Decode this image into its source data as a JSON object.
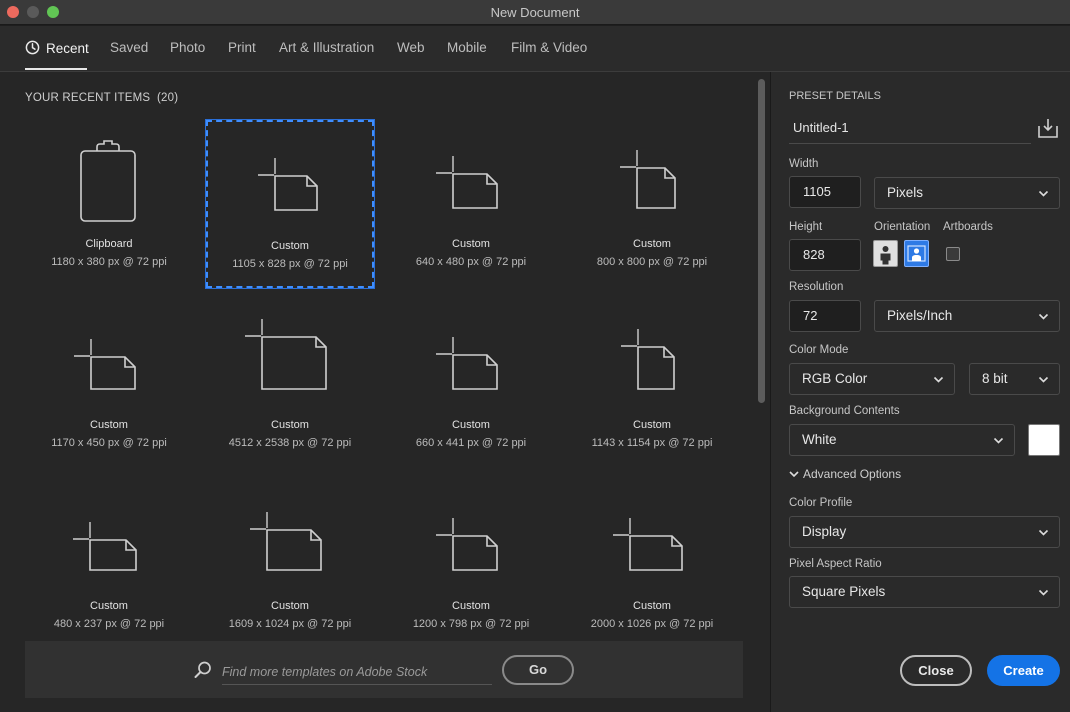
{
  "window": {
    "title": "New Document"
  },
  "tabs": [
    {
      "label": "Recent",
      "active": true
    },
    {
      "label": "Saved"
    },
    {
      "label": "Photo"
    },
    {
      "label": "Print"
    },
    {
      "label": "Art & Illustration"
    },
    {
      "label": "Web"
    },
    {
      "label": "Mobile"
    },
    {
      "label": "Film & Video"
    }
  ],
  "recent": {
    "title": "YOUR RECENT ITEMS",
    "count": "(20)",
    "items": [
      {
        "name": "Clipboard",
        "size": "1180 x 380 px @ 72 ppi",
        "icon": "clipboard-icon"
      },
      {
        "name": "Custom",
        "size": "1105 x 828 px @ 72 ppi",
        "icon": "document-icon",
        "selected": true
      },
      {
        "name": "Custom",
        "size": "640 x 480 px @ 72 ppi",
        "icon": "document-icon"
      },
      {
        "name": "Custom",
        "size": "800 x 800 px @ 72 ppi",
        "icon": "document-icon"
      },
      {
        "name": "Custom",
        "size": "1170 x 450 px @ 72 ppi",
        "icon": "document-icon"
      },
      {
        "name": "Custom",
        "size": "4512 x 2538 px @ 72 ppi",
        "icon": "document-icon"
      },
      {
        "name": "Custom",
        "size": "660 x 441 px @ 72 ppi",
        "icon": "document-icon"
      },
      {
        "name": "Custom",
        "size": "1143 x 1154 px @ 72 ppi",
        "icon": "document-icon"
      },
      {
        "name": "Custom",
        "size": "480 x 237 px @ 72 ppi",
        "icon": "document-icon"
      },
      {
        "name": "Custom",
        "size": "1609 x 1024 px @ 72 ppi",
        "icon": "document-icon"
      },
      {
        "name": "Custom",
        "size": "1200 x 798 px @ 72 ppi",
        "icon": "document-icon"
      },
      {
        "name": "Custom",
        "size": "2000 x 1026 px @ 72 ppi",
        "icon": "document-icon"
      }
    ]
  },
  "stock": {
    "placeholder": "Find more templates on Adobe Stock",
    "go_label": "Go"
  },
  "preset": {
    "section_title": "PRESET DETAILS",
    "name": "Untitled-1",
    "width_label": "Width",
    "width_value": "1105",
    "width_unit": "Pixels",
    "height_label": "Height",
    "height_value": "828",
    "orientation_label": "Orientation",
    "orientation": "landscape",
    "artboards_label": "Artboards",
    "artboards_checked": false,
    "resolution_label": "Resolution",
    "resolution_value": "72",
    "resolution_unit": "Pixels/Inch",
    "color_mode_label": "Color Mode",
    "color_mode": "RGB Color",
    "bit_depth": "8 bit",
    "background_label": "Background Contents",
    "background": "White",
    "background_swatch": "#ffffff",
    "advanced_label": "Advanced Options",
    "color_profile_label": "Color Profile",
    "color_profile": "Display",
    "pixel_aspect_label": "Pixel Aspect Ratio",
    "pixel_aspect": "Square Pixels"
  },
  "actions": {
    "close_label": "Close",
    "create_label": "Create"
  },
  "colors": {
    "accent": "#1473e6",
    "selection": "#3e8eff"
  }
}
